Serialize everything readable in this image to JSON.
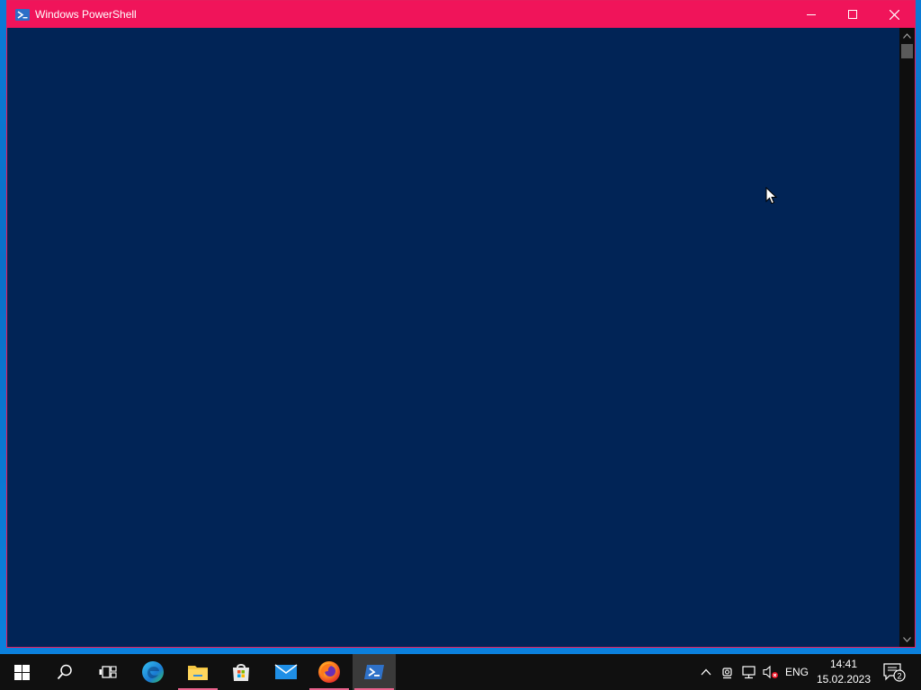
{
  "window": {
    "title": "Windows PowerShell",
    "titlebar_color": "#f0145a",
    "console_background": "#012456",
    "controls": {
      "minimize_icon": "minimize-icon",
      "maximize_icon": "maximize-icon",
      "close_icon": "close-icon"
    }
  },
  "taskbar": {
    "background": "#101010",
    "pinned": [
      {
        "name": "start",
        "icon": "windows-logo-icon",
        "running": false
      },
      {
        "name": "search",
        "icon": "search-icon",
        "running": false
      },
      {
        "name": "task-view",
        "icon": "task-view-icon",
        "running": false
      },
      {
        "name": "edge",
        "icon": "edge-icon",
        "running": false
      },
      {
        "name": "file-explorer",
        "icon": "folder-icon",
        "running": true
      },
      {
        "name": "microsoft-store",
        "icon": "store-icon",
        "running": false
      },
      {
        "name": "mail",
        "icon": "mail-icon",
        "running": false
      },
      {
        "name": "firefox",
        "icon": "firefox-icon",
        "running": true
      },
      {
        "name": "powershell",
        "icon": "powershell-icon",
        "running": true,
        "active": true
      }
    ],
    "tray": {
      "language": "ENG",
      "time": "14:41",
      "date": "15.02.2023",
      "notification_count": "2"
    }
  }
}
